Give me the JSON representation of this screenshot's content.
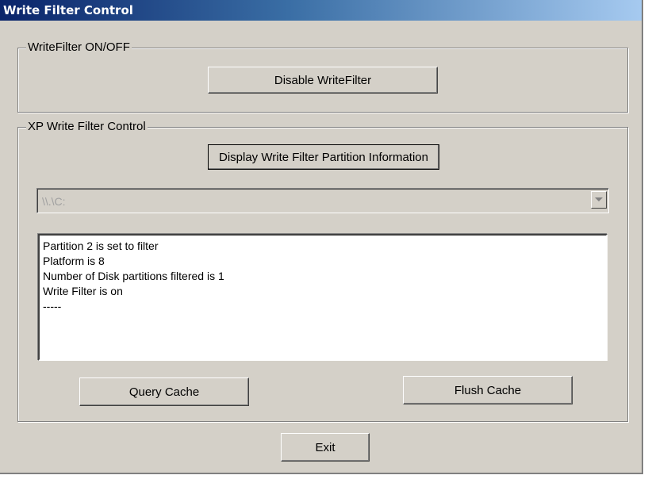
{
  "window": {
    "title": "Write Filter Control"
  },
  "group_onoff": {
    "legend": "WriteFilter ON/OFF",
    "toggle_button": "Disable WriteFilter"
  },
  "group_control": {
    "legend": "XP Write Filter Control",
    "display_button": "Display Write Filter Partition Information",
    "drive_select": {
      "value": "\\\\.\\C:",
      "enabled": false
    },
    "output_lines": [
      "Partition 2 is set to filter",
      "Platform is 8",
      "Number of Disk partitions filtered is 1",
      "Write Filter is on",
      "-----"
    ],
    "query_button": "Query Cache",
    "flush_button": "Flush Cache"
  },
  "exit_button": "Exit",
  "icons": {
    "combo_arrow": "chevron-down-icon"
  },
  "colors": {
    "title_gradient_start": "#0a246a",
    "title_gradient_end": "#a6caf0",
    "face": "#d4d0c8"
  }
}
